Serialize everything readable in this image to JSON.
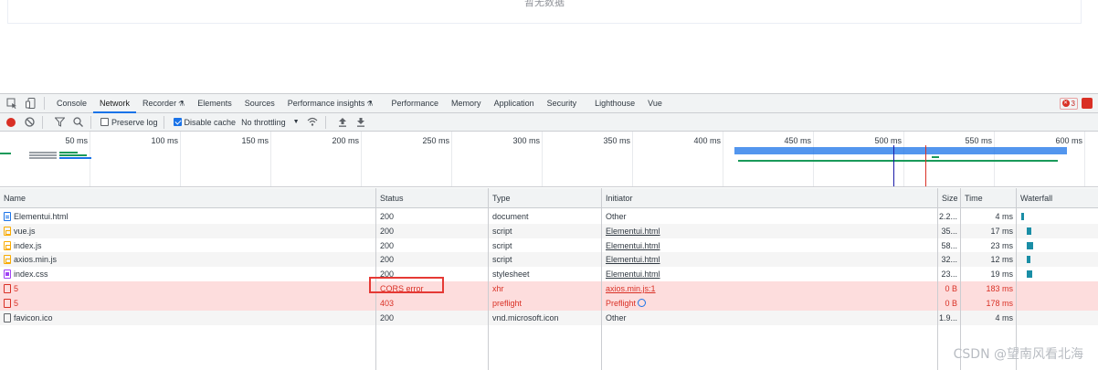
{
  "page": {
    "empty_text": "暂无数据"
  },
  "devtools": {
    "tabs": [
      {
        "label": "Console",
        "active": false
      },
      {
        "label": "Network",
        "active": true
      },
      {
        "label": "Recorder",
        "active": false
      },
      {
        "label": "Elements",
        "active": false
      },
      {
        "label": "Sources",
        "active": false
      },
      {
        "label": "Performance insights",
        "active": false
      },
      {
        "label": "Performance",
        "active": false
      },
      {
        "label": "Memory",
        "active": false
      },
      {
        "label": "Application",
        "active": false
      },
      {
        "label": "Security",
        "active": false
      },
      {
        "label": "Lighthouse",
        "active": false
      },
      {
        "label": "Vue",
        "active": false
      }
    ],
    "error_count": "3",
    "toolbar": {
      "preserve_log": "Preserve log",
      "disable_cache": "Disable cache",
      "throttling": "No throttling"
    },
    "overview_ticks": [
      "50 ms",
      "100 ms",
      "150 ms",
      "200 ms",
      "250 ms",
      "300 ms",
      "350 ms",
      "400 ms",
      "450 ms",
      "500 ms",
      "550 ms",
      "600 ms"
    ],
    "columns": [
      "Name",
      "Status",
      "Type",
      "Initiator",
      "Size",
      "Time",
      "Waterfall"
    ],
    "rows": [
      {
        "name": "Elementui.html",
        "icon": "document-icon",
        "status": "200",
        "type": "document",
        "initiator": "Other",
        "initiator_link": false,
        "size": "2.2...",
        "time": "4 ms",
        "error": false
      },
      {
        "name": "vue.js",
        "icon": "script-icon",
        "status": "200",
        "type": "script",
        "initiator": "Elementui.html",
        "initiator_link": true,
        "size": "35...",
        "time": "17 ms",
        "error": false
      },
      {
        "name": "index.js",
        "icon": "script-icon",
        "status": "200",
        "type": "script",
        "initiator": "Elementui.html",
        "initiator_link": true,
        "size": "58...",
        "time": "23 ms",
        "error": false
      },
      {
        "name": "axios.min.js",
        "icon": "script-icon",
        "status": "200",
        "type": "script",
        "initiator": "Elementui.html",
        "initiator_link": true,
        "size": "32...",
        "time": "12 ms",
        "error": false
      },
      {
        "name": "index.css",
        "icon": "stylesheet-icon",
        "status": "200",
        "type": "stylesheet",
        "initiator": "Elementui.html",
        "initiator_link": true,
        "size": "23...",
        "time": "19 ms",
        "error": false
      },
      {
        "name": "5",
        "icon": "xhr-icon",
        "status": "CORS error",
        "type": "xhr",
        "initiator": "axios.min.js:1",
        "initiator_link": true,
        "size": "0 B",
        "time": "183 ms",
        "error": true
      },
      {
        "name": "5",
        "icon": "xhr-icon",
        "status": "403",
        "type": "preflight",
        "initiator": "Preflight",
        "initiator_link": false,
        "size": "0 B",
        "time": "178 ms",
        "error": true
      },
      {
        "name": "favicon.ico",
        "icon": "file-icon",
        "status": "200",
        "type": "vnd.microsoft.icon",
        "initiator": "Other",
        "initiator_link": false,
        "size": "1.9...",
        "time": "4 ms",
        "error": false
      }
    ]
  },
  "watermark": "CSDN @望南风看北海",
  "colors": {
    "accent": "#1a73e8",
    "error": "#d93025",
    "error_row": "#fddddd",
    "highlight_box": "#e53935"
  }
}
